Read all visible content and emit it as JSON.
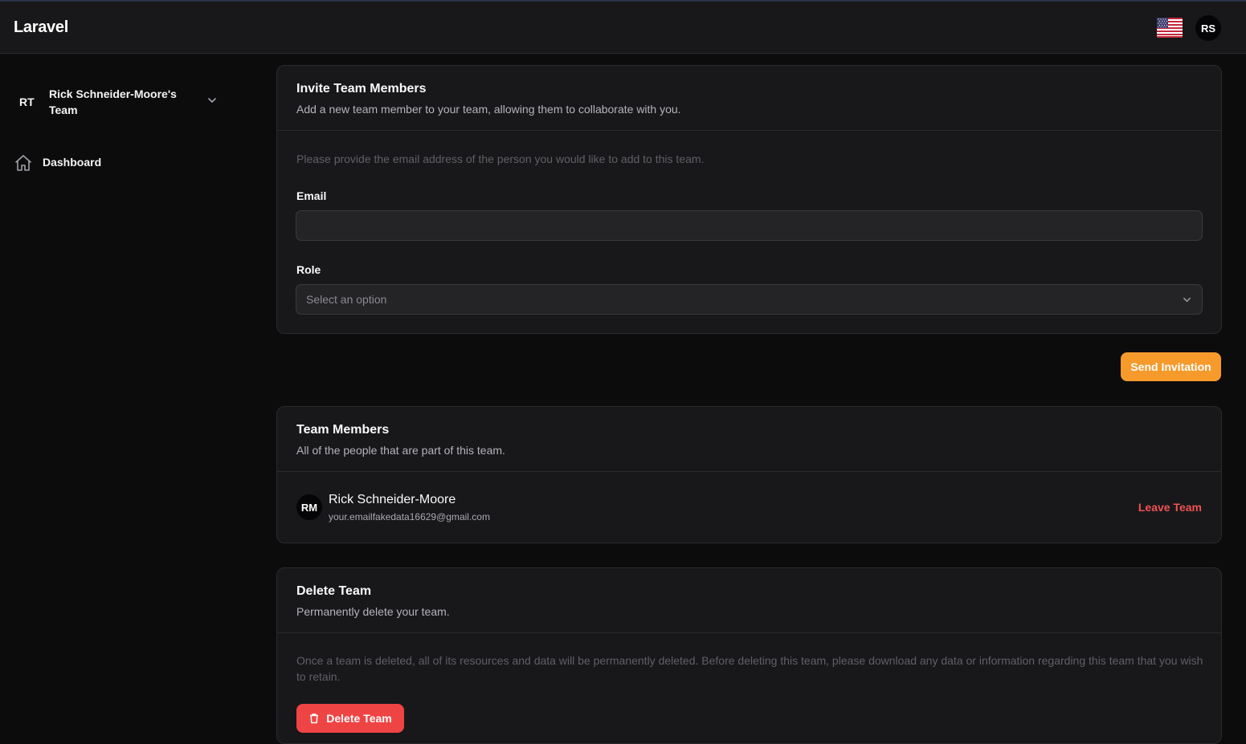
{
  "header": {
    "brand": "Laravel",
    "locale_flag": "us-flag-icon",
    "user_initials": "RS"
  },
  "sidebar": {
    "team": {
      "initials": "RT",
      "name": "Rick Schneider-Moore's Team"
    },
    "nav": [
      {
        "label": "Dashboard",
        "icon": "home-icon"
      }
    ]
  },
  "invite": {
    "title": "Invite Team Members",
    "subtitle": "Add a new team member to your team, allowing them to collaborate with you.",
    "description": "Please provide the email address of the person you would like to add to this team.",
    "email_label": "Email",
    "email_value": "",
    "role_label": "Role",
    "role_placeholder": "Select an option",
    "submit_label": "Send Invitation"
  },
  "members": {
    "title": "Team Members",
    "subtitle": "All of the people that are part of this team.",
    "list": [
      {
        "initials": "RM",
        "name": "Rick Schneider-Moore",
        "email": "your.emailfakedata16629@gmail.com",
        "action": "Leave Team"
      }
    ]
  },
  "delete_team": {
    "title": "Delete Team",
    "subtitle": "Permanently delete your team.",
    "description": "Once a team is deleted, all of its resources and data will be permanently deleted. Before deleting this team, please download any data or information regarding this team that you wish to retain.",
    "button_label": "Delete Team"
  },
  "colors": {
    "accent": "#f59a2b",
    "danger": "#ef4444",
    "danger_text": "#f05252",
    "background": "#0c0c0d",
    "card": "#18181b"
  }
}
